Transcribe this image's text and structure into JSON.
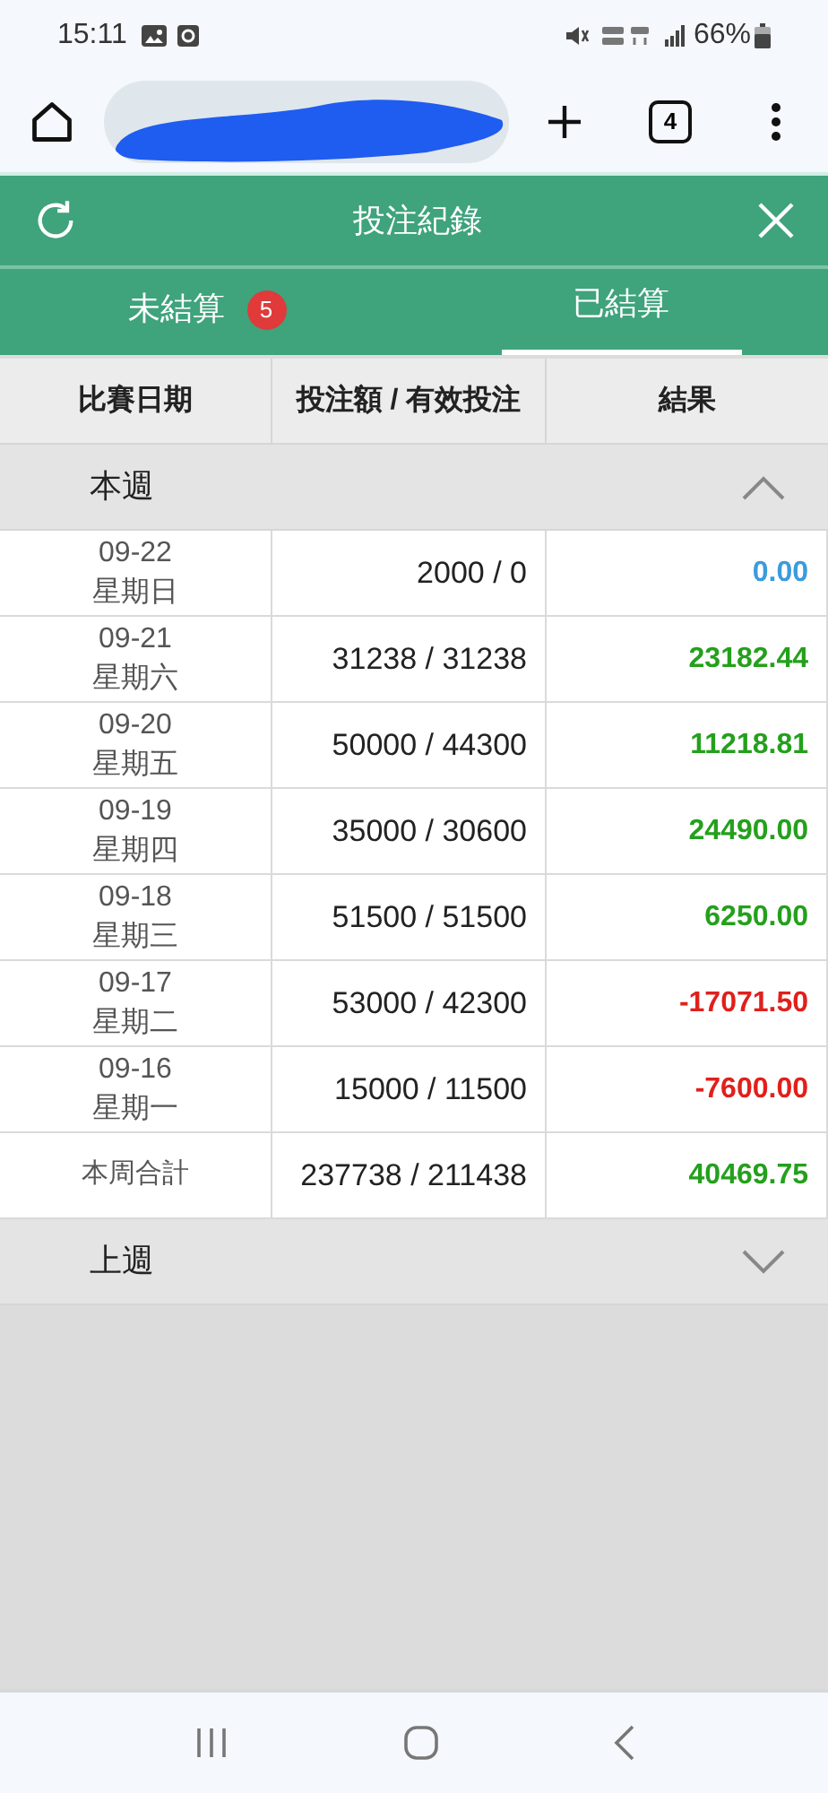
{
  "status_bar": {
    "time": "15:11",
    "battery": "66%"
  },
  "browser": {
    "tab_count": "4"
  },
  "header": {
    "title": "投注紀錄"
  },
  "tabs": [
    {
      "label": "未結算",
      "badge": "5",
      "selected": false
    },
    {
      "label": "已結算",
      "selected": true
    }
  ],
  "table": {
    "columns": [
      "比賽日期",
      "投注額 / 有效投注",
      "結果"
    ],
    "sections": [
      {
        "label": "本週",
        "expanded": true,
        "rows": [
          {
            "date": "09-22",
            "weekday": "星期日",
            "amount": "2000 / 0",
            "result": "0.00",
            "color": "#3b9bdc"
          },
          {
            "date": "09-21",
            "weekday": "星期六",
            "amount": "31238 / 31238",
            "result": "23182.44",
            "color": "#24a01c"
          },
          {
            "date": "09-20",
            "weekday": "星期五",
            "amount": "50000 / 44300",
            "result": "11218.81",
            "color": "#24a01c"
          },
          {
            "date": "09-19",
            "weekday": "星期四",
            "amount": "35000 / 30600",
            "result": "24490.00",
            "color": "#24a01c"
          },
          {
            "date": "09-18",
            "weekday": "星期三",
            "amount": "51500 / 51500",
            "result": "6250.00",
            "color": "#24a01c"
          },
          {
            "date": "09-17",
            "weekday": "星期二",
            "amount": "53000 / 42300",
            "result": "-17071.50",
            "color": "#e0201c"
          },
          {
            "date": "09-16",
            "weekday": "星期一",
            "amount": "15000 / 11500",
            "result": "-7600.00",
            "color": "#e0201c"
          }
        ],
        "total": {
          "label": "本周合計",
          "amount": "237738 / 211438",
          "result": "40469.75",
          "color": "#24a01c"
        }
      },
      {
        "label": "上週",
        "expanded": false
      }
    ]
  }
}
